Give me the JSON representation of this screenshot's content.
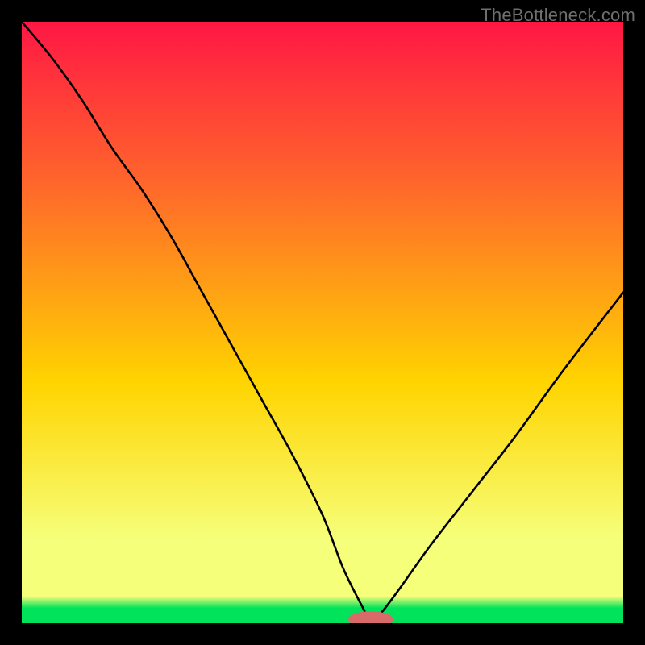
{
  "watermark": "TheBottleneck.com",
  "colors": {
    "frame": "#000000",
    "curve": "#000000",
    "marker_fill": "#d86a6a",
    "green_band": "#00e35a",
    "grad_top": "#ff1744",
    "grad_mid_upper": "#ff6a2a",
    "grad_mid": "#ffd400",
    "grad_lower": "#f6ff7a",
    "grad_bottom": "#00e35a"
  },
  "chart_data": {
    "type": "line",
    "title": "",
    "xlabel": "",
    "ylabel": "",
    "xlim": [
      0,
      100
    ],
    "ylim": [
      0,
      100
    ],
    "x": [
      0,
      5,
      10,
      15,
      20,
      25,
      30,
      35,
      40,
      45,
      50,
      53.5,
      57,
      58,
      60,
      63,
      68,
      75,
      82,
      90,
      100
    ],
    "values": [
      100,
      94,
      87,
      79,
      72,
      64,
      55,
      46,
      37,
      28,
      18,
      9,
      2,
      0,
      2,
      6,
      13,
      22,
      31,
      42,
      55
    ],
    "marker": {
      "x": 58,
      "y": 0,
      "rx": 3.7,
      "ry": 1.4
    },
    "notes": "Vertical background gradient from red (top) through orange/yellow to thin green band at bottom; black V-shaped curve with minimum near x≈58; small rounded pink marker at the minimum on the x-axis."
  }
}
